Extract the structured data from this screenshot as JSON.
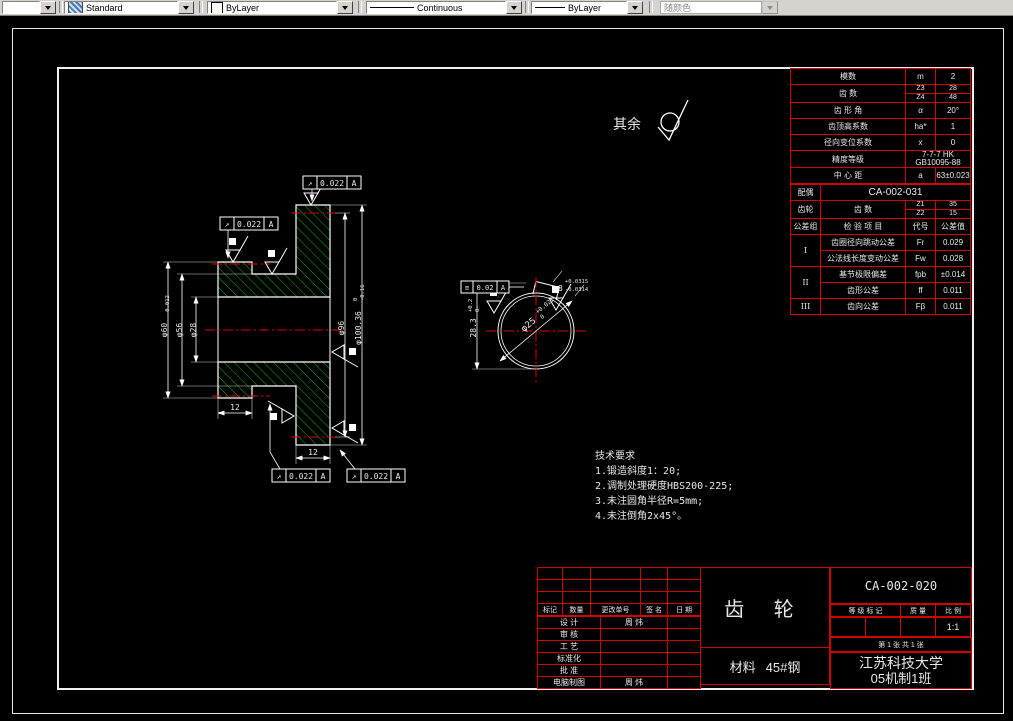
{
  "toolbar": {
    "style_combo": {
      "value": "Standard"
    },
    "color_combo": {
      "value": "ByLayer"
    },
    "linetype_combo": {
      "value": "Continuous"
    },
    "lineweight_combo": {
      "value": "ByLayer"
    },
    "plotstyle_combo": {
      "value": "随颜色"
    }
  },
  "drawing": {
    "surplus_note": "其余",
    "tech_req": {
      "title": "技术要求",
      "items": [
        "1.锻造斜度1：20;",
        "2.调制处理硬度HBS200-225;",
        "3.未注圆角半径R=5mm;",
        "4.未注倒角2x45°。"
      ]
    },
    "fcf_runout": {
      "sym": "↗",
      "val": "0.022",
      "datum": "A"
    },
    "fcf_symmetry": {
      "sym": "≡",
      "val": "0.02",
      "datum": "A"
    },
    "dims": {
      "d60": "φ60",
      "d60_sub": "-0.012",
      "d56": "φ56",
      "d28": "φ28",
      "d96": "φ96",
      "d100": "φ100.36",
      "d100_sup": "0",
      "d100_sub": "-0.16",
      "hub_w": "12",
      "rim_w": "12",
      "bore": "φ25",
      "bore_sup": "+0.021",
      "bore_sub": "0",
      "key_h": "28.3",
      "key_h_sup": "+0.2",
      "key_h_sub": "0",
      "key_w": "8",
      "key_w_sup": "+0.0315",
      "key_w_sub": "-0.0314"
    }
  },
  "gear_table": {
    "rows": {
      "module": {
        "name": "模数",
        "sym": "m",
        "val": "2"
      },
      "teeth": {
        "name": "齿 数",
        "sym_a": "Z3",
        "val_a": "28",
        "sym_b": "Z4",
        "val_b": "48"
      },
      "angle": {
        "name": "齿 形 角",
        "sym": "α",
        "val": "20°"
      },
      "addendum": {
        "name": "齿顶高系数",
        "sym": "ha*",
        "val": "1"
      },
      "shift": {
        "name": "径向变位系数",
        "sym": "x",
        "val": "0"
      },
      "precision": {
        "name": "精度等级",
        "val_line1": "7-7-7 HK",
        "val_line2": "GB10095-88"
      },
      "center_dist": {
        "name": "中 心 距",
        "sym": "a",
        "val": "63±0.023"
      },
      "mate": {
        "name": "配偶",
        "val": "CA-002-031"
      },
      "mate_teeth": {
        "name": "齿轮",
        "item": "齿 数",
        "sym_a": "Z1",
        "val_a": "35",
        "sym_b": "Z2",
        "val_b": "15"
      }
    },
    "check_header": {
      "group": "公差组",
      "item": "检 验 项 目",
      "code": "代号",
      "tol": "公差值"
    },
    "checks": {
      "g1": "I",
      "g2": "II",
      "g3": "III",
      "c1": {
        "item": "齿圈径向跳动公差",
        "code": "Fr",
        "val": "0.029"
      },
      "c2": {
        "item": "公法线长度变动公差",
        "code": "Fw",
        "val": "0.028"
      },
      "c3": {
        "item": "基节极限偏差",
        "code": "fpb",
        "val": "±0.014"
      },
      "c4": {
        "item": "齿形公差",
        "code": "ff",
        "val": "0.011"
      },
      "c5": {
        "item": "齿向公差",
        "code": "Fβ",
        "val": "0.011"
      }
    }
  },
  "title_block": {
    "part_name": "齿 轮",
    "material_label": "材料",
    "material_value": "45#钢",
    "drawing_no": "CA-002-020",
    "rev_header": {
      "mark": "标记",
      "qty": "数量",
      "change_no": "更改单号",
      "sign": "签 名",
      "date": "日 期"
    },
    "sign_rows": {
      "design": {
        "label": "设 计",
        "name": "周  炜"
      },
      "check": {
        "label": "审 核",
        "name": ""
      },
      "process": {
        "label": "工 艺",
        "name": ""
      },
      "standard": {
        "label": "标准化",
        "name": ""
      },
      "approve": {
        "label": "批 准",
        "name": ""
      },
      "cad": {
        "label": "电脑制图",
        "name": "周  炜"
      }
    },
    "info_header": {
      "grade": "等 级 标 记",
      "weight": "质 量",
      "scale": "比 例"
    },
    "scale_value": "1:1",
    "sheet_info": "第 1 张 共 1 张",
    "school": "江苏科技大学",
    "class_name": "05机制1班"
  }
}
